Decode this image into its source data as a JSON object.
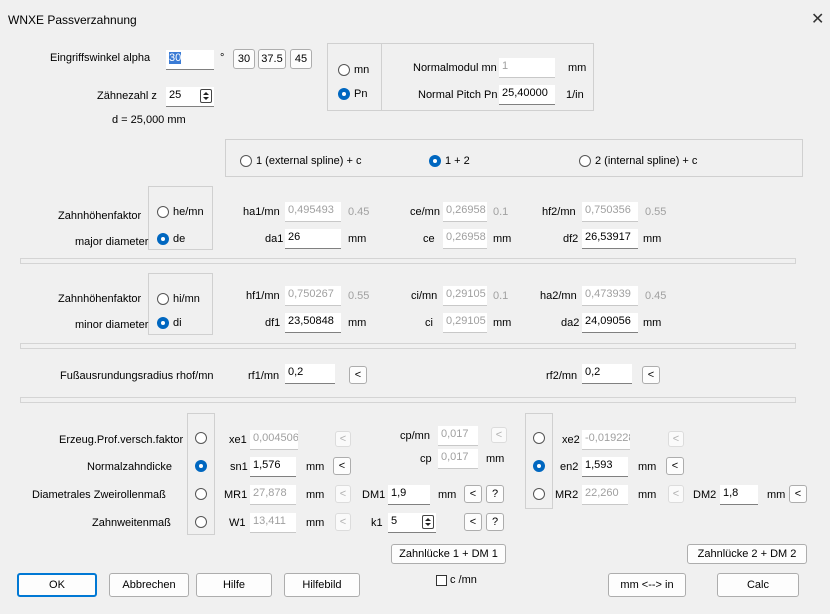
{
  "window": {
    "title": "WNXE  Passverzahnung",
    "close_glyph": "✕"
  },
  "angle": {
    "label": "Eingriffswinkel alpha",
    "value": "30",
    "unit": "°",
    "presets": [
      "30",
      "37.5",
      "45"
    ]
  },
  "teeth": {
    "label": "Zähnezahl z",
    "value": "25"
  },
  "diameter_text": "d = 25,000 mm",
  "module": {
    "radio_mn": "mn",
    "radio_pn": "Pn",
    "mn_label": "Normalmodul mn",
    "mn_value": "1",
    "mn_unit": "mm",
    "pn_label": "Normal Pitch Pn",
    "pn_value": "25,40000",
    "pn_unit": "1/in"
  },
  "spline_mode": {
    "opt1": "1 (external spline) + c",
    "opt2": "1 + 2",
    "opt3": "2 (internal spline) + c"
  },
  "major": {
    "label1": "Zahnhöhenfaktor",
    "label2": "major diameter",
    "radio_he": "he/mn",
    "radio_de": "de",
    "ha1_label": "ha1/mn",
    "ha1_value": "0,495493",
    "ha1_hint": "0.45",
    "ce_label": "ce/mn",
    "ce_value": "0,26958",
    "ce_hint": "0.1",
    "hf2_label": "hf2/mn",
    "hf2_value": "0,750356",
    "hf2_hint": "0.55",
    "da1_label": "da1",
    "da1_value": "26",
    "da1_unit": "mm",
    "ce_abs_label": "ce",
    "ce_abs_value": "0,26958",
    "ce_abs_unit": "mm",
    "df2_label": "df2",
    "df2_value": "26,53917",
    "df2_unit": "mm"
  },
  "minor": {
    "label1": "Zahnhöhenfaktor",
    "label2": "minor diameter",
    "radio_hi": "hi/mn",
    "radio_di": "di",
    "hf1_label": "hf1/mn",
    "hf1_value": "0,750267",
    "hf1_hint": "0.55",
    "ci_label": "ci/mn",
    "ci_value": "0,29105",
    "ci_hint": "0.1",
    "ha2_label": "ha2/mn",
    "ha2_value": "0,473939",
    "ha2_hint": "0.45",
    "df1_label": "df1",
    "df1_value": "23,50848",
    "df1_unit": "mm",
    "ci_abs_label": "ci",
    "ci_abs_value": "0,29105",
    "ci_abs_unit": "mm",
    "da2_label": "da2",
    "da2_value": "24,09056",
    "da2_unit": "mm"
  },
  "root_radius": {
    "label": "Fußausrundungsradius rhof/mn",
    "rf1_label": "rf1/mn",
    "rf1_value": "0,2",
    "rf2_label": "rf2/mn",
    "rf2_value": "0,2",
    "arrow": "<"
  },
  "profile": {
    "row1": "Erzeug.Prof.versch.faktor",
    "row2": "Normalzahndicke",
    "row3": "Diametrales Zweirollenmaß",
    "row4": "Zahnweitenmaß",
    "xe1_label": "xe1",
    "xe1_value": "0,004506",
    "sn1_label": "sn1",
    "sn1_value": "1,576",
    "sn1_unit": "mm",
    "mr1_label": "MR1",
    "mr1_value": "27,878",
    "mr1_unit": "mm",
    "w1_label": "W1",
    "w1_value": "13,411",
    "w1_unit": "mm",
    "cp_label": "cp/mn",
    "cp_value": "0,017",
    "cp_abs_label": "cp",
    "cp_abs_value": "0,017",
    "cp_abs_unit": "mm",
    "dm1_label": "DM1",
    "dm1_value": "1,9",
    "dm1_unit": "mm",
    "k1_label": "k1",
    "k1_value": "5",
    "xe2_label": "xe2",
    "xe2_value": "-0,019228",
    "en2_label": "en2",
    "en2_value": "1,593",
    "en2_unit": "mm",
    "mr2_label": "MR2",
    "mr2_value": "22,260",
    "mr2_unit": "mm",
    "dm2_label": "DM2",
    "dm2_value": "1,8",
    "dm2_unit": "mm",
    "arrow": "<",
    "question": "?",
    "gap1_button": "Zahnlücke 1 + DM 1",
    "gap2_button": "Zahnlücke 2 + DM 2",
    "c_per_mn": "c /mn"
  },
  "footer": {
    "ok": "OK",
    "cancel": "Abbrechen",
    "help": "Hilfe",
    "help_image": "Hilfebild",
    "convert": "mm <--> in",
    "calc": "Calc"
  },
  "colors": {
    "accent": "#0067c0",
    "selection": "#3a7bd5"
  }
}
